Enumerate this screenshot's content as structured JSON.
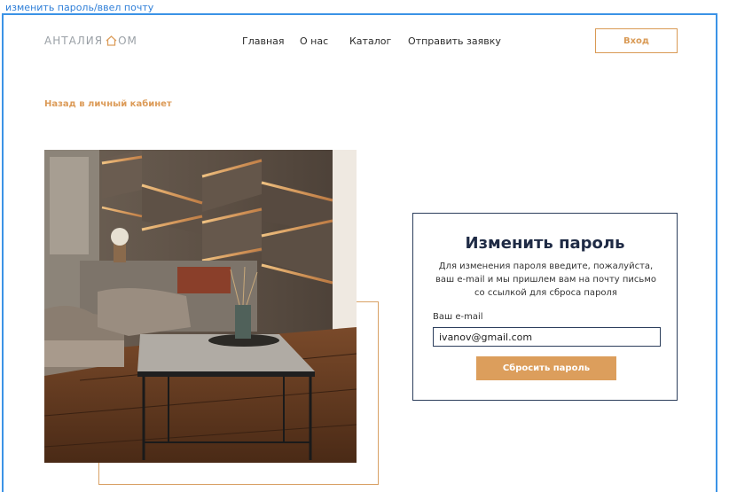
{
  "frame": {
    "label": "изменить пароль/ввел почту"
  },
  "header": {
    "logo_text_left": "АНТАЛИЯ",
    "logo_text_right": "ОМ",
    "nav": [
      "Главная",
      "О нас",
      "Каталог",
      "Отправить заявку"
    ],
    "login_label": "Вход"
  },
  "back_link": "Назад в личный кабинет",
  "card": {
    "title": "Изменить пароль",
    "description": "Для изменения пароля введите, пожалуйста, ваш e-mail и мы пришлем вам на почту письмо со ссылкой для сброса пароля",
    "email_label": "Ваш e-mail",
    "email_value": "ivanov@gmail.com",
    "submit_label": "Сбросить пароль"
  },
  "colors": {
    "accent": "#dc9e5c",
    "frame_blue": "#3b93e6",
    "card_border": "#2c3e5c"
  }
}
